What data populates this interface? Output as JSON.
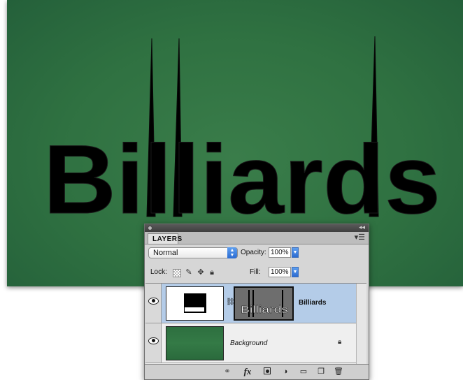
{
  "canvas": {
    "text": "Billiards",
    "background_color": "#2f7141"
  },
  "panel": {
    "tab_label": "LAYERS",
    "menu_icon": "panel-menu-icon",
    "blend_mode": "Normal",
    "opacity_label": "Opacity:",
    "opacity_value": "100%",
    "lock_label": "Lock:",
    "fill_label": "Fill:",
    "fill_value": "100%",
    "layers": [
      {
        "name": "Billiards",
        "mask_text": "Billiards",
        "selected": true
      },
      {
        "name": "Background",
        "locked": true
      }
    ],
    "bottom_icons": [
      "link-layers-icon",
      "fx-icon",
      "add-mask-icon",
      "adjustment-layer-icon",
      "new-group-icon",
      "new-layer-icon",
      "trash-icon"
    ],
    "fx_label": "fx"
  }
}
